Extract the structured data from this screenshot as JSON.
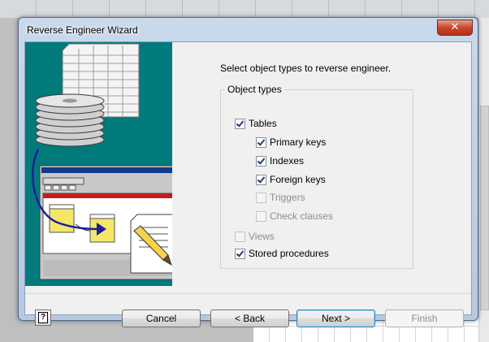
{
  "window": {
    "title": "Reverse Engineer Wizard",
    "close_glyph": "✕"
  },
  "instruction": "Select object types to reverse engineer.",
  "object_types": {
    "caption": "Object types",
    "tables": {
      "label": "Tables",
      "checked": true,
      "enabled": true
    },
    "primary_keys": {
      "label": "Primary keys",
      "checked": true,
      "enabled": true
    },
    "indexes": {
      "label": "Indexes",
      "checked": true,
      "enabled": true
    },
    "foreign_keys": {
      "label": "Foreign keys",
      "checked": true,
      "enabled": true
    },
    "triggers": {
      "label": "Triggers",
      "checked": false,
      "enabled": false
    },
    "check_clauses": {
      "label": "Check clauses",
      "checked": false,
      "enabled": false
    },
    "views": {
      "label": "Views",
      "checked": false,
      "enabled": false
    },
    "stored_procedures": {
      "label": "Stored procedures",
      "checked": true,
      "enabled": true
    }
  },
  "buttons": {
    "help": "?",
    "cancel": "Cancel",
    "back": "< Back",
    "next": "Next >",
    "finish": "Finish"
  },
  "colors": {
    "illustration_bg": "#007a7b",
    "close_button": "#c8452c",
    "default_button_border": "#3c7fb1"
  },
  "icons": {
    "close": "close-icon",
    "help": "help-icon",
    "illustration": "database-wizard-illustration"
  }
}
